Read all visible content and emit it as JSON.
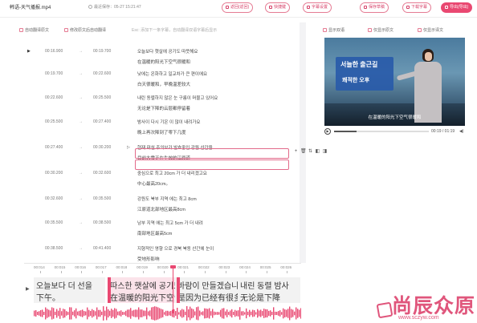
{
  "topbar": {
    "file_title": "韩语-天气播报.mp4",
    "save_time": "最近保存：05-27 15:21:47",
    "buttons": [
      "返回(返回)",
      "快捷键",
      "字幕设置",
      "保存草稿",
      "下载字幕",
      "导出(导出)"
    ]
  },
  "toolbar": {
    "show_original": "自动翻译原文",
    "show_translation": "修改原文后自动翻译",
    "hint": "Esc: 添加下一条字幕，自动翻译双语字幕后显示"
  },
  "rows": [
    {
      "start": "00:16.900",
      "end": "00:19.700",
      "line1": "오늘보다 햇살에 공기도 따뜻해요",
      "line2": "在温暖的阳光下空气很暖和"
    },
    {
      "start": "00:19.700",
      "end": "00:22.600",
      "line1": "낮에는 온화하고 일교차가 큰 편이에요",
      "line2": "白天很暖和，早晚温差较大"
    },
    {
      "start": "00:22.600",
      "end": "00:25.500",
      "line1": "내린 동렬하지 않은 눈 구름이 머물고 있어요",
      "line2": "无论是下降的云层都停留着"
    },
    {
      "start": "00:25.500",
      "end": "00:27.400",
      "line1": "밤사이 다시 기온 이 많이 내려가요",
      "line2": "晚上再次降到了零下几度"
    },
    {
      "start": "00:27.400",
      "end": "00:30.200",
      "line1": "현재 대설 주의보가 발효중인 강원 산간을",
      "line2": "目前大雪正在生效的江原道"
    },
    {
      "start": "00:30.200",
      "end": "00:32.600",
      "line1": "중심으로 최고 20cm 가 더 내리겠고요",
      "line2": "中心最高20cm。"
    },
    {
      "start": "00:32.600",
      "end": "00:35.500",
      "line1": "강원도 북부 지역 에는 최고 8cm",
      "line2": "江原道北部地区最高8cm"
    },
    {
      "start": "00:35.500",
      "end": "00:38.500",
      "line1": "남부 지역 에는 최고 5cm 가 더 내려",
      "line2": "南部地区最高5cm"
    },
    {
      "start": "00:38.500",
      "end": "00:41.400",
      "line1": "지형적인 영향 으로 경북 북동 산간에 눈이",
      "line2": "受地形影响"
    }
  ],
  "edit_tools": [
    "+",
    "🗑",
    "⇅",
    "◧",
    "◨"
  ],
  "right_panel": {
    "tab_original": "显示双语",
    "tab_trans": "仅显示原文",
    "tab_both": "仅显示译文"
  },
  "video": {
    "banner_line1": "서늘한 출근길",
    "banner_line2": "쾌적한 오후",
    "subtitle": "在温暖的阳光下空气很暖和",
    "time": "00:19 / 01:19",
    "progress": 0.24
  },
  "timeline": {
    "ticks": [
      "00:014",
      "00:015",
      "00:016",
      "00:017",
      "00:018",
      "00:019",
      "00:020",
      "00:021",
      "00:022",
      "00:023",
      "00:024",
      "00:025",
      "00:026"
    ],
    "clips": [
      {
        "line1": "오늘보다 더 선을",
        "line2": "下午。"
      },
      {
        "line1": "따스한 햇살에 공기도",
        "line2": "在温暖的阳光下空气"
      },
      {
        "line1": "바람이 만들겠습니다",
        "line2": "是因为已经有很多雪"
      },
      {
        "line1": "내린 동렬 밤사",
        "line2": "无论是下降"
      }
    ]
  },
  "watermark": {
    "text": "尚辰众原",
    "url": "www.sczyw.com"
  },
  "colors": {
    "accent": "#e94871",
    "border_accent": "#e57b93"
  }
}
